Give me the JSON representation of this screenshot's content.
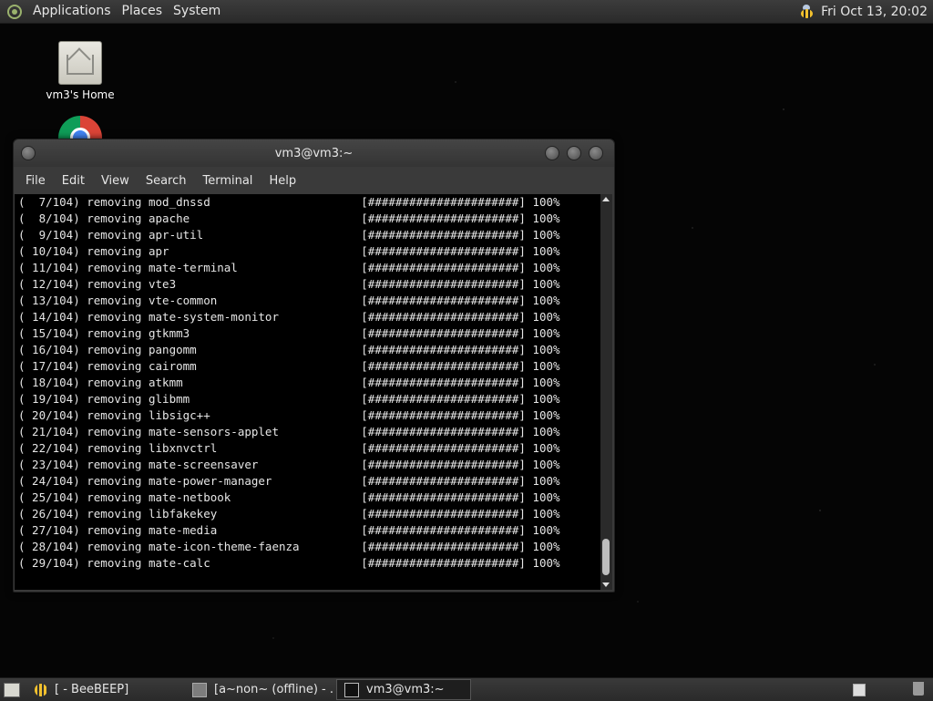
{
  "top_panel": {
    "menus": [
      "Applications",
      "Places",
      "System"
    ],
    "clock": "Fri Oct 13, 20:02"
  },
  "desktop": {
    "home_label": "vm3's Home",
    "icons": [
      "home-icon",
      "chrome-icon"
    ]
  },
  "window": {
    "title": "vm3@vm3:~",
    "menu": [
      "File",
      "Edit",
      "View",
      "Search",
      "Terminal",
      "Help"
    ]
  },
  "terminal": {
    "lines": [
      "(  7/104) removing mod_dnssd                      [######################] 100%",
      "(  8/104) removing apache                         [######################] 100%",
      "(  9/104) removing apr-util                       [######################] 100%",
      "( 10/104) removing apr                            [######################] 100%",
      "( 11/104) removing mate-terminal                  [######################] 100%",
      "( 12/104) removing vte3                           [######################] 100%",
      "( 13/104) removing vte-common                     [######################] 100%",
      "( 14/104) removing mate-system-monitor            [######################] 100%",
      "( 15/104) removing gtkmm3                         [######################] 100%",
      "( 16/104) removing pangomm                        [######################] 100%",
      "( 17/104) removing cairomm                        [######################] 100%",
      "( 18/104) removing atkmm                          [######################] 100%",
      "( 19/104) removing glibmm                         [######################] 100%",
      "( 20/104) removing libsigc++                      [######################] 100%",
      "( 21/104) removing mate-sensors-applet            [######################] 100%",
      "( 22/104) removing libxnvctrl                     [######################] 100%",
      "( 23/104) removing mate-screensaver               [######################] 100%",
      "( 24/104) removing mate-power-manager             [######################] 100%",
      "( 25/104) removing mate-netbook                   [######################] 100%",
      "( 26/104) removing libfakekey                     [######################] 100%",
      "( 27/104) removing mate-media                     [######################] 100%",
      "( 28/104) removing mate-icon-theme-faenza         [######################] 100%",
      "( 29/104) removing mate-calc                      [######################] 100%"
    ]
  },
  "taskbar": {
    "tasks": [
      "[ - BeeBEEP]",
      "[a~non~ (offline) - ...",
      "vm3@vm3:~"
    ]
  }
}
